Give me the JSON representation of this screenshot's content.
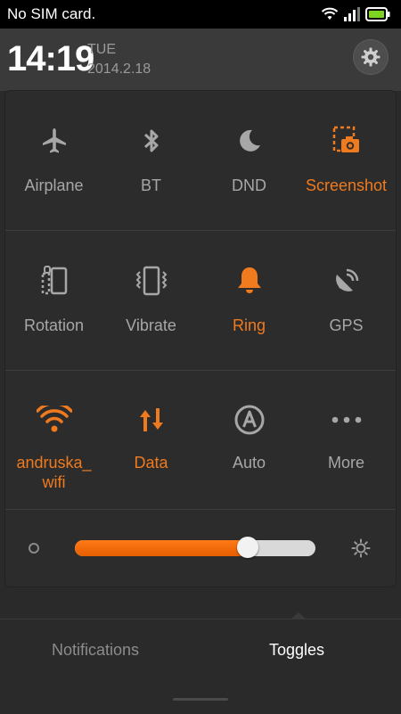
{
  "status_bar": {
    "carrier": "No SIM card."
  },
  "header": {
    "time": "14:19",
    "day": "TUE",
    "date": "2014.2.18"
  },
  "colors": {
    "accent": "#f07a1e",
    "inactive": "#a7a7a7"
  },
  "toggles": [
    {
      "label": "Airplane",
      "icon": "airplane-icon",
      "on": false
    },
    {
      "label": "BT",
      "icon": "bluetooth-icon",
      "on": false
    },
    {
      "label": "DND",
      "icon": "moon-icon",
      "on": false
    },
    {
      "label": "Screenshot",
      "icon": "screenshot-icon",
      "on": true
    },
    {
      "label": "Rotation",
      "icon": "rotation-icon",
      "on": false
    },
    {
      "label": "Vibrate",
      "icon": "vibrate-icon",
      "on": false
    },
    {
      "label": "Ring",
      "icon": "bell-icon",
      "on": true
    },
    {
      "label": "GPS",
      "icon": "gps-icon",
      "on": false
    },
    {
      "label": "andruska_\nwifi",
      "icon": "wifi-icon",
      "on": true
    },
    {
      "label": "Data",
      "icon": "data-icon",
      "on": true
    },
    {
      "label": "Auto",
      "icon": "auto-brightness-icon",
      "on": false
    },
    {
      "label": "More",
      "icon": "more-icon",
      "on": false
    }
  ],
  "brightness": {
    "level": 0.72
  },
  "tabs": {
    "notifications": "Notifications",
    "toggles": "Toggles",
    "active": "Toggles"
  }
}
